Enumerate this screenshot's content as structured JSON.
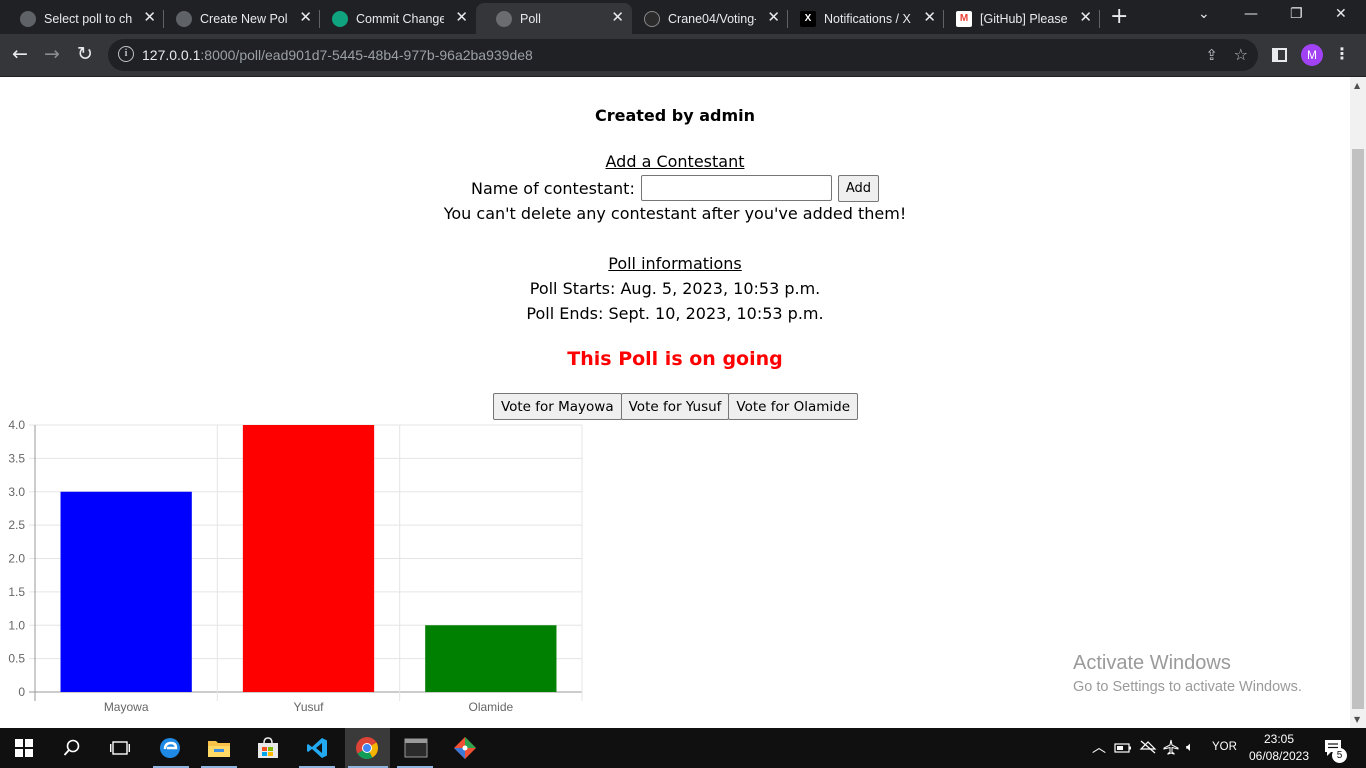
{
  "browser": {
    "tabs": [
      {
        "title": "Select poll to cha",
        "active": false
      },
      {
        "title": "Create New Poll",
        "active": false
      },
      {
        "title": "Commit Changes",
        "active": false
      },
      {
        "title": "Poll",
        "active": true
      },
      {
        "title": "Crane04/Voting-",
        "active": false
      },
      {
        "title": "Notifications / X",
        "active": false
      },
      {
        "title": "[GitHub] Please v",
        "active": false
      }
    ],
    "url_host": "127.0.0.1",
    "url_rest": ":8000/poll/ead901d7-5445-48b4-977b-96a2ba939de8",
    "profile_initial": "M"
  },
  "page": {
    "created_by": "Created by admin",
    "add_heading": "Add a Contestant",
    "name_label": "Name of contestant:",
    "name_value": "",
    "add_button": "Add",
    "warning": "You can't delete any contestant after you've added them!",
    "info_heading": "Poll informations",
    "starts": "Poll Starts: Aug. 5, 2023, 10:53 p.m.",
    "ends": "Poll Ends: Sept. 10, 2023, 10:53 p.m.",
    "status": "This Poll is on going",
    "vote_buttons": [
      "Vote for Mayowa",
      "Vote for Yusuf",
      "Vote for Olamide"
    ]
  },
  "chart_data": {
    "type": "bar",
    "categories": [
      "Mayowa",
      "Yusuf",
      "Olamide"
    ],
    "values": [
      3,
      4,
      1
    ],
    "colors": [
      "#0000ff",
      "#ff0000",
      "#008000"
    ],
    "y_ticks": [
      "0",
      "0.5",
      "1.0",
      "1.5",
      "2.0",
      "2.5",
      "3.0",
      "3.5",
      "4.0"
    ],
    "ylim": [
      0,
      4
    ],
    "grid": true,
    "legend": "none"
  },
  "watermark": {
    "line1": "Activate Windows",
    "line2": "Go to Settings to activate Windows."
  },
  "taskbar": {
    "language": "YOR",
    "time": "23:05",
    "date": "06/08/2023",
    "notification_count": "5"
  }
}
